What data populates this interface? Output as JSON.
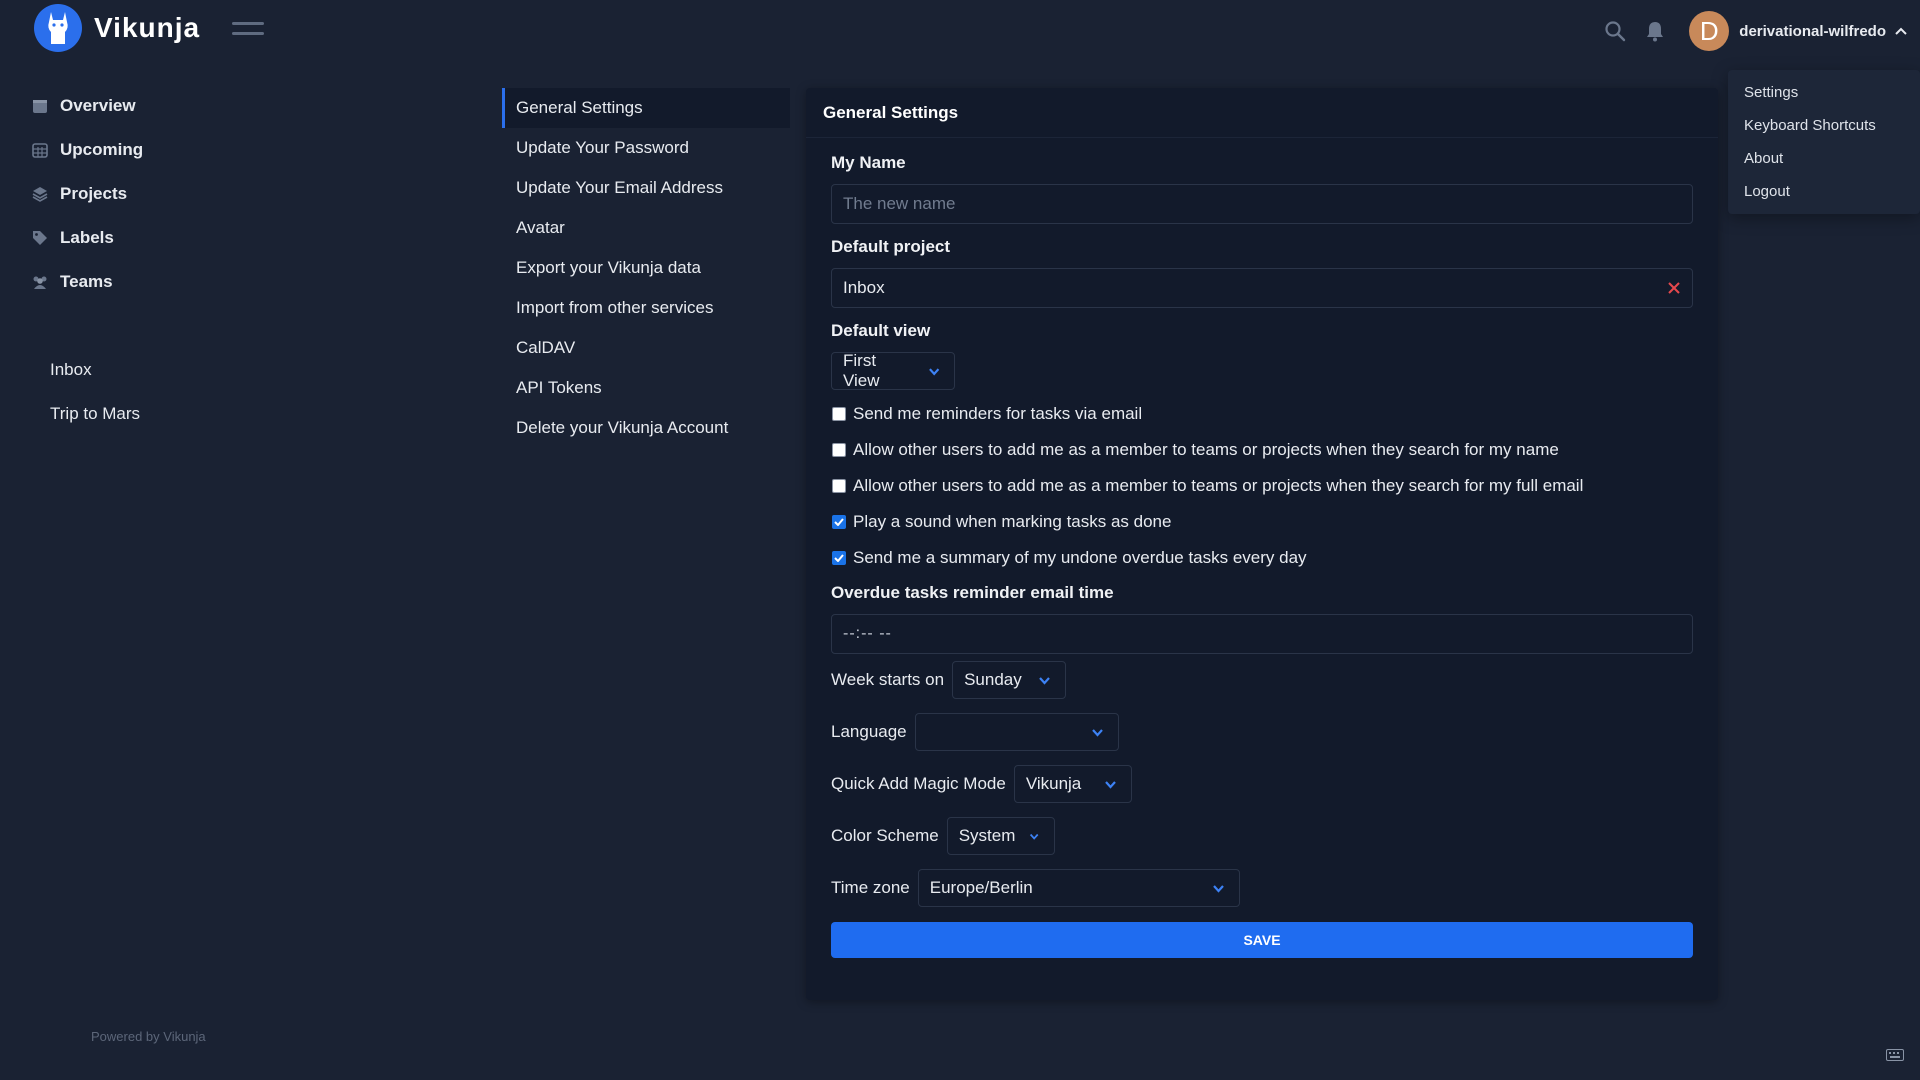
{
  "app": {
    "name": "Vikunja",
    "brand_color": "#2b6fec",
    "logo_icon": "llama-icon"
  },
  "header": {
    "search_icon": "search-icon",
    "notifications_icon": "bell-icon",
    "user": {
      "avatar_letter": "D",
      "name": "derivational-wilfredo",
      "menu_icon": "chevron-up-icon"
    }
  },
  "user_menu": {
    "items": [
      "Settings",
      "Keyboard Shortcuts",
      "About",
      "Logout"
    ]
  },
  "sidebar": {
    "nav": [
      {
        "label": "Overview",
        "icon": "calendar-icon"
      },
      {
        "label": "Upcoming",
        "icon": "calendar-grid-icon"
      },
      {
        "label": "Projects",
        "icon": "layers-icon"
      },
      {
        "label": "Labels",
        "icon": "tags-icon"
      },
      {
        "label": "Teams",
        "icon": "users-icon"
      }
    ],
    "projects": [
      "Inbox",
      "Trip to Mars"
    ],
    "footer": "Powered by Vikunja"
  },
  "settings_nav": {
    "items": [
      "General Settings",
      "Update Your Password",
      "Update Your Email Address",
      "Avatar",
      "Export your Vikunja data",
      "Import from other services",
      "CalDAV",
      "API Tokens",
      "Delete your Vikunja Account"
    ],
    "active": "General Settings"
  },
  "general": {
    "title": "General Settings",
    "my_name": {
      "label": "My Name",
      "placeholder": "The new name",
      "value": ""
    },
    "default_project": {
      "label": "Default project",
      "value": "Inbox"
    },
    "default_view": {
      "label": "Default view",
      "value": "First View"
    },
    "checkboxes": [
      {
        "label": "Send me reminders for tasks via email",
        "checked": false
      },
      {
        "label": "Allow other users to add me as a member to teams or projects when they search for my name",
        "checked": false
      },
      {
        "label": "Allow other users to add me as a member to teams or projects when they search for my full email",
        "checked": false
      },
      {
        "label": "Play a sound when marking tasks as done",
        "checked": true
      },
      {
        "label": "Send me a summary of my undone overdue tasks every day",
        "checked": true
      }
    ],
    "overdue_time": {
      "label": "Overdue tasks reminder email time",
      "value": "--:-- --"
    },
    "week_start": {
      "label": "Week starts on",
      "value": "Sunday"
    },
    "language": {
      "label": "Language",
      "value": ""
    },
    "quick_add": {
      "label": "Quick Add Magic Mode",
      "value": "Vikunja"
    },
    "color_scheme": {
      "label": "Color Scheme",
      "value": "System"
    },
    "timezone": {
      "label": "Time zone",
      "value": "Europe/Berlin"
    },
    "save_label": "Save"
  },
  "colors": {
    "background": "#1a2233",
    "card": "#121a2b",
    "primary": "#1f6cf0",
    "danger": "#e5484d"
  }
}
